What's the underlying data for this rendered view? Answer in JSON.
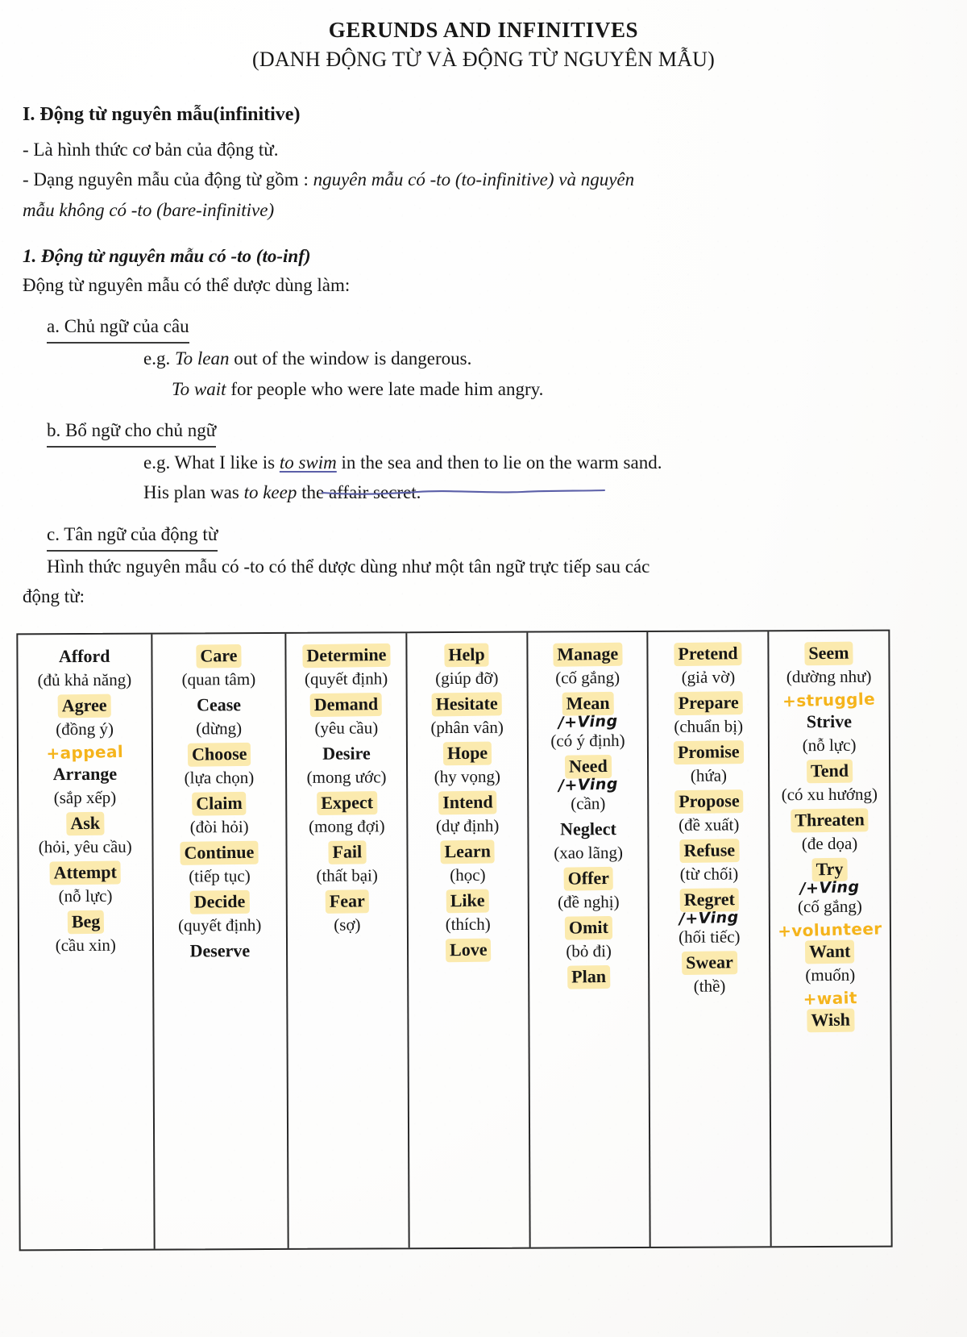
{
  "document": {
    "title": "GERUNDS AND INFINITIVES",
    "subtitle": "(DANH ĐỘNG TỪ VÀ ĐỘNG TỪ NGUYÊN MẪU)",
    "section_I": {
      "heading": "I. Động từ nguyên mẫu(infinitive)",
      "bullet_1": "- Là hình thức cơ bản của động từ.",
      "bullet_2_plain": "- Dạng nguyên mẫu của động từ gồm : ",
      "bullet_2_italic": "nguyên mẫu có -to (to-infinitive) và nguyên",
      "bullet_2_line2_italic": "mẫu không có    -to (bare-infinitive)"
    },
    "subsection_1": {
      "heading": "1. Động từ nguyên mẫu có -to (to-inf)",
      "intro": "Động từ nguyên mẫu có thể dược dùng làm:",
      "a": {
        "label": "a. Chủ ngữ của câu",
        "eg_prefix": "e.g. ",
        "example_1_italic": "To lean",
        "example_1_rest": " out of the window is dangerous.",
        "example_2_italic": "To wait",
        "example_2_rest": " for people who were late made him angry."
      },
      "b": {
        "label": "b. Bổ ngữ cho chủ ngữ",
        "eg_prefix": "e.g.  ",
        "example_1_pre": "What I like is ",
        "example_1_underlined": "to swim",
        "example_1_post": " in the sea and then to lie on the warm sand.",
        "example_2_pre": "His plan was ",
        "example_2_italic": "to keep",
        "example_2_post": " the affair secret."
      },
      "c": {
        "label": "c. Tân ngữ của động từ",
        "text_line1": "Hình thức nguyên mẫu có -to có thể dược dùng như một tân ngữ trực tiếp sau các",
        "text_line2": "động từ:"
      }
    }
  },
  "verb_table": {
    "columns": [
      {
        "entries": [
          {
            "word": "Afford",
            "highlight": false,
            "meaning": "(đủ khả năng)"
          },
          {
            "word": "Agree",
            "highlight": true,
            "meaning": "(đồng ý)",
            "note_after": "+appeal",
            "note_color": "orange"
          },
          {
            "word": "Arrange",
            "highlight": false,
            "meaning": "(sắp xếp)"
          },
          {
            "word": "Ask",
            "highlight": true,
            "meaning": "(hỏi, yêu cầu)"
          },
          {
            "word": "Attempt",
            "highlight": true,
            "meaning": "(nỗ lực)"
          },
          {
            "word": "Beg",
            "highlight": true,
            "meaning": "(cầu xin)"
          }
        ]
      },
      {
        "entries": [
          {
            "word": "Care",
            "highlight": true,
            "meaning": "(quan tâm)"
          },
          {
            "word": "Cease",
            "highlight": false,
            "meaning": "(dừng)"
          },
          {
            "word": "Choose",
            "highlight": true,
            "meaning": "(lựa chọn)"
          },
          {
            "word": "Claim",
            "highlight": true,
            "meaning": "(đòi hỏi)"
          },
          {
            "word": "Continue",
            "highlight": true,
            "meaning": "(tiếp tục)"
          },
          {
            "word": "Decide",
            "highlight": true,
            "meaning": "(quyết định)"
          },
          {
            "word": "Deserve",
            "highlight": false,
            "meaning": ""
          }
        ]
      },
      {
        "entries": [
          {
            "word": "Determine",
            "highlight": true,
            "meaning": "(quyết định)"
          },
          {
            "word": "Demand",
            "highlight": true,
            "meaning": "(yêu cầu)"
          },
          {
            "word": "Desire",
            "highlight": false,
            "meaning": "(mong ước)"
          },
          {
            "word": "Expect",
            "highlight": true,
            "meaning": "(mong đợi)"
          },
          {
            "word": "Fail",
            "highlight": true,
            "meaning": "(thất bại)"
          },
          {
            "word": "Fear",
            "highlight": true,
            "meaning": "(sợ)"
          }
        ]
      },
      {
        "entries": [
          {
            "word": "Help",
            "highlight": true,
            "meaning": "(giúp đỡ)"
          },
          {
            "word": "Hesitate",
            "highlight": true,
            "meaning": "(phân vân)"
          },
          {
            "word": "Hope",
            "highlight": true,
            "meaning": "(hy vọng)"
          },
          {
            "word": "Intend",
            "highlight": true,
            "meaning": "(dự định)"
          },
          {
            "word": "Learn",
            "highlight": true,
            "meaning": "(học)"
          },
          {
            "word": "Like",
            "highlight": true,
            "meaning": "(thích)"
          },
          {
            "word": "Love",
            "highlight": true,
            "meaning": ""
          }
        ]
      },
      {
        "entries": [
          {
            "word": "Manage",
            "highlight": true,
            "meaning": "(cố gắng)"
          },
          {
            "word": "Mean",
            "highlight": true,
            "note_before_meaning": "/+Ving",
            "note_color": "black",
            "meaning": "(có ý định)"
          },
          {
            "word": "Need",
            "highlight": true,
            "note_before_meaning": "/+Ving",
            "note_color": "black",
            "meaning": "(cần)"
          },
          {
            "word": "Neglect",
            "highlight": false,
            "meaning": "(xao lãng)"
          },
          {
            "word": "Offer",
            "highlight": true,
            "meaning": "(đề nghị)"
          },
          {
            "word": "Omit",
            "highlight": true,
            "meaning": "(bỏ đi)"
          },
          {
            "word": "Plan",
            "highlight": true,
            "meaning": ""
          }
        ]
      },
      {
        "entries": [
          {
            "word": "Pretend",
            "highlight": true,
            "meaning": "(giả vờ)"
          },
          {
            "word": "Prepare",
            "highlight": true,
            "meaning": "(chuẩn bị)"
          },
          {
            "word": "Promise",
            "highlight": true,
            "meaning": "(hứa)"
          },
          {
            "word": "Propose",
            "highlight": true,
            "meaning": "(đề xuất)"
          },
          {
            "word": "Refuse",
            "highlight": true,
            "meaning": "(từ chối)"
          },
          {
            "word": "Regret",
            "highlight": true,
            "note_before_meaning": "/+Ving",
            "note_color": "black",
            "meaning": "(hối tiếc)"
          },
          {
            "word": "Swear",
            "highlight": true,
            "meaning": "(thề)"
          }
        ]
      },
      {
        "entries": [
          {
            "word": "Seem",
            "highlight": true,
            "meaning": "(dường như)",
            "note_after": "+struggle",
            "note_color": "orange"
          },
          {
            "word": "Strive",
            "highlight": false,
            "meaning": "(nỗ lực)"
          },
          {
            "word": "Tend",
            "highlight": true,
            "meaning": "(có xu hướng)"
          },
          {
            "word": "Threaten",
            "highlight": true,
            "meaning": "(đe dọa)"
          },
          {
            "word": "Try",
            "highlight": true,
            "note_before_meaning": "/+Ving",
            "note_color": "black",
            "meaning": "(cố gắng)",
            "note_after": "+volunteer",
            "note_color_after": "orange"
          },
          {
            "word": "Want",
            "highlight": true,
            "meaning": "(muốn)",
            "note_after": "+wait",
            "note_color_after": "orange"
          },
          {
            "word": "Wish",
            "highlight": true,
            "meaning": ""
          }
        ]
      }
    ]
  },
  "colors": {
    "highlighter": "#fbeaae",
    "pen_orange": "#f5b41c",
    "pen_blue": "#5b5fa8",
    "ink": "#171717"
  }
}
